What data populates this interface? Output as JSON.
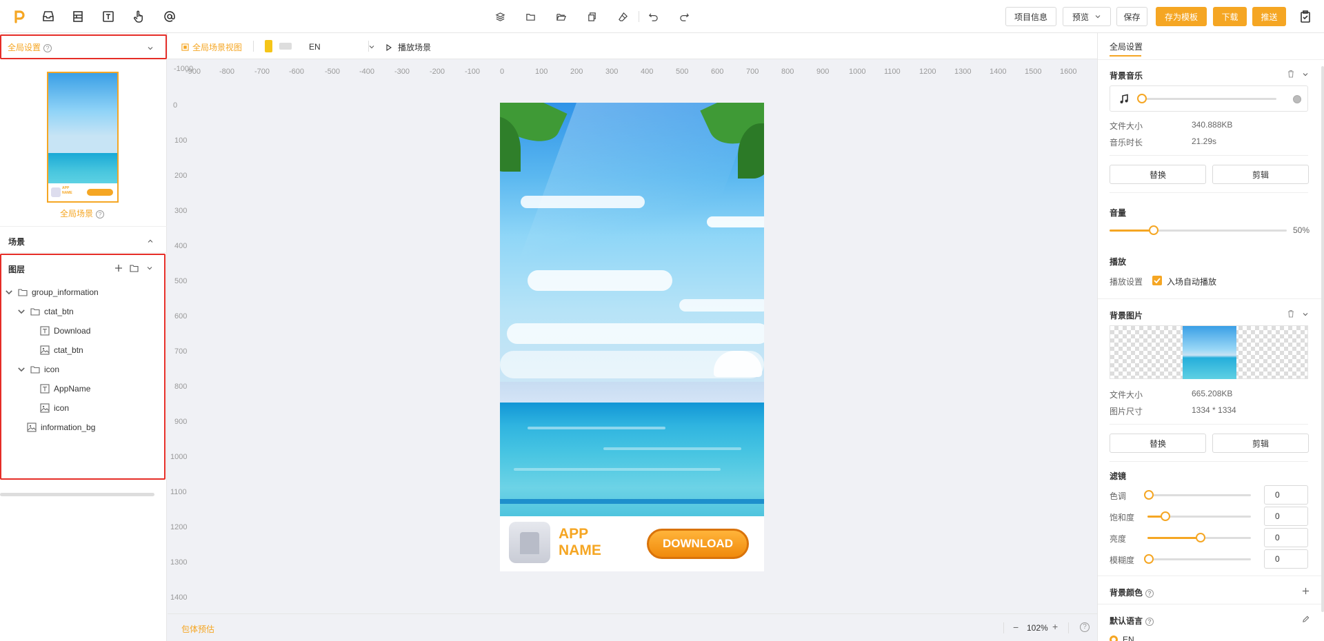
{
  "topbar": {
    "project_info": "项目信息",
    "preview": "预览",
    "save": "保存",
    "save_template": "存为模板",
    "download": "下载",
    "push": "推送"
  },
  "left": {
    "global_settings": "全局设置",
    "global_scene": "全局场景",
    "scene_section": "场景",
    "layers_section": "图层",
    "thumb_app": "APP",
    "thumb_name": "NAME",
    "layers": [
      {
        "label": "group_information",
        "type": "folder",
        "expanded": true
      },
      {
        "label": "ctat_btn",
        "type": "folder",
        "expanded": true
      },
      {
        "label": "Download",
        "type": "text"
      },
      {
        "label": "ctat_btn",
        "type": "image"
      },
      {
        "label": "icon",
        "type": "folder",
        "expanded": true
      },
      {
        "label": "AppName",
        "type": "text"
      },
      {
        "label": "icon",
        "type": "image"
      },
      {
        "label": "information_bg",
        "type": "image"
      }
    ]
  },
  "canvas": {
    "view_label": "全局场景视图",
    "language": "EN",
    "play_scene": "播放场景",
    "ruler_x": [
      "-1000",
      "-900",
      "-800",
      "-700",
      "-600",
      "-500",
      "-400",
      "-300",
      "-200",
      "-100",
      "0",
      "100",
      "200",
      "300",
      "400",
      "500",
      "600",
      "700",
      "800",
      "900",
      "1000",
      "1100",
      "1200",
      "1300",
      "1400",
      "1500",
      "1600"
    ],
    "ruler_y": [
      "0",
      "100",
      "200",
      "300",
      "400",
      "500",
      "600",
      "700",
      "800",
      "900",
      "1000",
      "1100",
      "1200",
      "1300",
      "1400"
    ],
    "app_line1": "APP",
    "app_line2": "NAME",
    "download_btn": "DOWNLOAD",
    "package_estimate": "包体预估",
    "zoom_minus": "−",
    "zoom": "102%",
    "zoom_plus": "+",
    "help": "?"
  },
  "right": {
    "tab": "全局设置",
    "bg_music": "背景音乐",
    "file_size_label": "文件大小",
    "music_size": "340.888KB",
    "music_duration_label": "音乐时长",
    "music_duration": "21.29s",
    "replace": "替换",
    "edit": "剪辑",
    "volume_label": "音量",
    "volume_value": "50%",
    "volume_level": 0.25,
    "play_label": "播放",
    "play_setting_label": "播放设置",
    "autoplay_label": "入场自动播放",
    "bg_image": "背景图片",
    "image_size": "665.208KB",
    "image_dim_label": "图片尺寸",
    "image_dim": "1334 * 1334",
    "filter_label": "滤镜",
    "filters": [
      {
        "label": "色调",
        "value": "0",
        "level": 0
      },
      {
        "label": "饱和度",
        "value": "0",
        "level": 0.16
      },
      {
        "label": "亮度",
        "value": "0",
        "level": 0.5
      },
      {
        "label": "模糊度",
        "value": "0",
        "level": 0
      }
    ],
    "bg_color": "背景颜色",
    "default_lang": "默认语言",
    "lang_option": "EN"
  },
  "colors": {
    "accent": "#f5a623",
    "highlight_red": "#e52d27"
  }
}
